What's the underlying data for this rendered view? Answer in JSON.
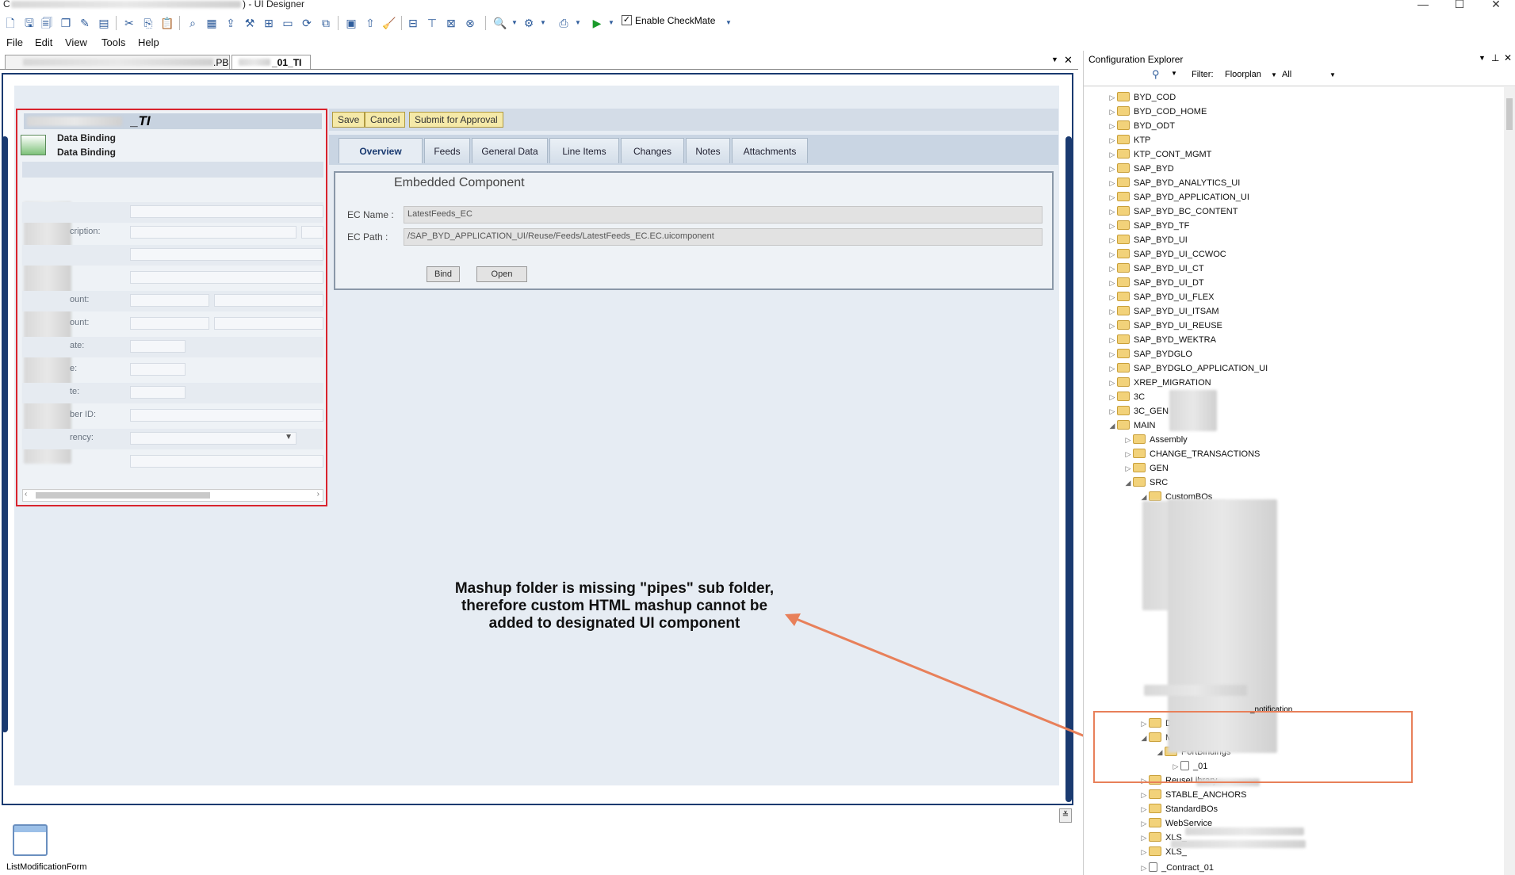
{
  "window": {
    "title_prefix": "C",
    "title_suffix": ") - UI Designer",
    "minimize": "—",
    "maximize": "☐",
    "close": "✕"
  },
  "toolbar": {
    "checkmate_label": "Enable CheckMate",
    "checkmate_checked": true
  },
  "menu": [
    "File",
    "Edit",
    "View",
    "Tools",
    "Help"
  ],
  "doc_tabs": [
    {
      "label": ".PB"
    },
    {
      "label": "_01_TI"
    }
  ],
  "designer": {
    "panel_title_suffix": "_TI",
    "data_binding_1": "Data Binding",
    "data_binding_2": "Data Binding",
    "field_labels": [
      "",
      "cription:",
      "",
      "",
      "ount:",
      "ount:",
      "ate:",
      "e:",
      "te:",
      "ber ID:",
      "rency:",
      ""
    ],
    "actions": {
      "save": "Save",
      "cancel": "Cancel",
      "submit": "Submit for Approval"
    },
    "tabs": [
      "Overview",
      "Feeds",
      "General Data",
      "Line Items",
      "Changes",
      "Notes",
      "Attachments"
    ],
    "active_tab": "Overview",
    "embedded_component": {
      "title": "Embedded Component",
      "ec_name_label": "EC Name :",
      "ec_name_value": "LatestFeeds_EC",
      "ec_path_label": "EC Path :",
      "ec_path_value": "/SAP_BYD_APPLICATION_UI/Reuse/Feeds/LatestFeeds_EC.EC.uicomponent",
      "bind_button": "Bind",
      "open_button": "Open"
    }
  },
  "annotation": {
    "text": "Mashup folder is missing \"pipes\" sub folder, therefore custom HTML mashup cannot be added to designated UI component"
  },
  "bottom_component": {
    "label": "ListModificationForm"
  },
  "config_explorer": {
    "title": "Configuration Explorer",
    "filter_label": "Filter:",
    "filter_value": "Floorplan",
    "filter_scope": "All",
    "tree": [
      {
        "label": "BYD_COD",
        "indent": 0,
        "expanded": false
      },
      {
        "label": "BYD_COD_HOME",
        "indent": 0,
        "expanded": false
      },
      {
        "label": "BYD_ODT",
        "indent": 0,
        "expanded": false
      },
      {
        "label": "KTP",
        "indent": 0,
        "expanded": false
      },
      {
        "label": "KTP_CONT_MGMT",
        "indent": 0,
        "expanded": false
      },
      {
        "label": "SAP_BYD",
        "indent": 0,
        "expanded": false
      },
      {
        "label": "SAP_BYD_ANALYTICS_UI",
        "indent": 0,
        "expanded": false
      },
      {
        "label": "SAP_BYD_APPLICATION_UI",
        "indent": 0,
        "expanded": false
      },
      {
        "label": "SAP_BYD_BC_CONTENT",
        "indent": 0,
        "expanded": false
      },
      {
        "label": "SAP_BYD_TF",
        "indent": 0,
        "expanded": false
      },
      {
        "label": "SAP_BYD_UI",
        "indent": 0,
        "expanded": false
      },
      {
        "label": "SAP_BYD_UI_CCWOC",
        "indent": 0,
        "expanded": false
      },
      {
        "label": "SAP_BYD_UI_CT",
        "indent": 0,
        "expanded": false
      },
      {
        "label": "SAP_BYD_UI_DT",
        "indent": 0,
        "expanded": false
      },
      {
        "label": "SAP_BYD_UI_FLEX",
        "indent": 0,
        "expanded": false
      },
      {
        "label": "SAP_BYD_UI_ITSAM",
        "indent": 0,
        "expanded": false
      },
      {
        "label": "SAP_BYD_UI_REUSE",
        "indent": 0,
        "expanded": false
      },
      {
        "label": "SAP_BYD_WEKTRA",
        "indent": 0,
        "expanded": false
      },
      {
        "label": "SAP_BYDGLO",
        "indent": 0,
        "expanded": false
      },
      {
        "label": "SAP_BYDGLO_APPLICATION_UI",
        "indent": 0,
        "expanded": false
      },
      {
        "label": "XREP_MIGRATION",
        "indent": 0,
        "expanded": false
      },
      {
        "label": "3C",
        "indent": 0,
        "expanded": false
      },
      {
        "label": "3C_GEN",
        "indent": 0,
        "expanded": false
      },
      {
        "label": "MAIN",
        "indent": 0,
        "expanded": true
      },
      {
        "label": "Assembly",
        "indent": 1,
        "expanded": false
      },
      {
        "label": "CHANGE_TRANSACTIONS",
        "indent": 1,
        "expanded": false
      },
      {
        "label": "GEN",
        "indent": 1,
        "expanded": false
      },
      {
        "label": "SRC",
        "indent": 1,
        "expanded": true
      },
      {
        "label": "CustomBOs",
        "indent": 2,
        "expanded": true
      }
    ],
    "tree_lower": [
      {
        "label": "DataSources",
        "indent": 2,
        "expanded": false
      },
      {
        "label": "Mashups",
        "indent": 2,
        "expanded": true
      },
      {
        "label": "PortBindings",
        "indent": 3,
        "expanded": true
      },
      {
        "label": "_01",
        "indent": 4,
        "expanded": false,
        "file": true
      },
      {
        "label": "ReuseLibrary",
        "indent": 2,
        "expanded": false
      },
      {
        "label": "STABLE_ANCHORS",
        "indent": 2,
        "expanded": false
      },
      {
        "label": "StandardBOs",
        "indent": 2,
        "expanded": false
      },
      {
        "label": "WebService",
        "indent": 2,
        "expanded": false
      },
      {
        "label": "XLS_",
        "indent": 2,
        "expanded": false
      },
      {
        "label": "XLS_",
        "indent": 2,
        "expanded": false
      },
      {
        "label": "_Contract_01",
        "indent": 2,
        "expanded": false,
        "file": true
      }
    ],
    "notification_fragment": "_notification"
  },
  "colors": {
    "highlight_red": "#d9232d",
    "callout_orange": "#e8805a",
    "frame_blue": "#1a3a70"
  }
}
